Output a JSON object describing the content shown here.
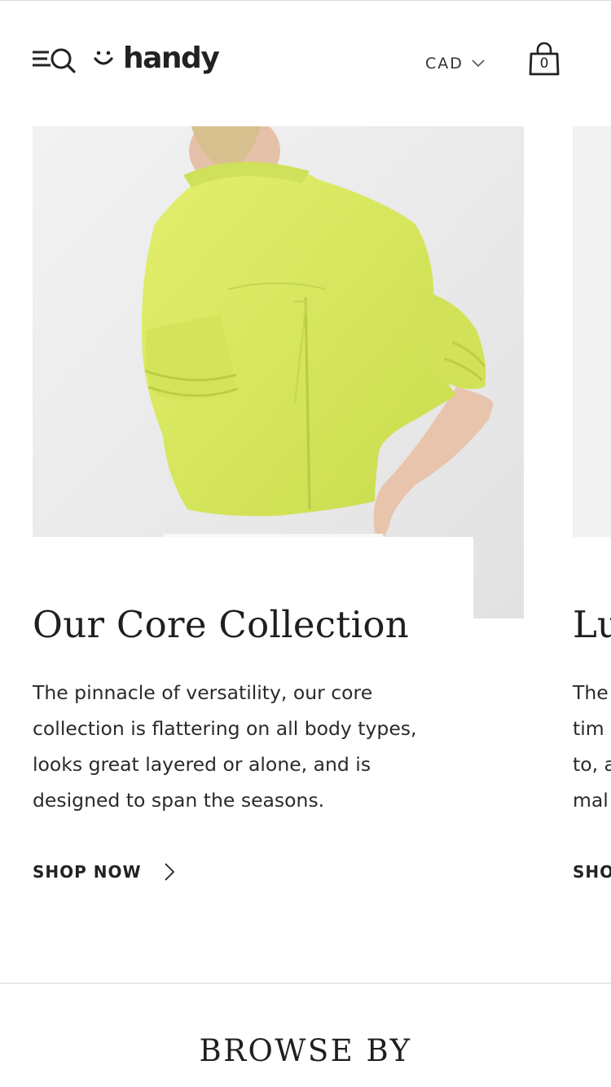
{
  "header": {
    "brand": "handy",
    "currency": "CAD",
    "cart_count": "0"
  },
  "collections": [
    {
      "title": "Our Core Collection",
      "description": "The pinnacle of versatility, our core collection is flattering on all body types, looks great layered or alone, and is designed to span the seasons.",
      "cta": "SHOP NOW"
    },
    {
      "title": "Lu",
      "description_lines": [
        "The",
        "tim",
        "to, a",
        "mal"
      ],
      "cta": "SHO"
    }
  ],
  "browse": {
    "title": "BROWSE BY"
  },
  "colors": {
    "shirt": "#d8ea5c",
    "text": "#222222",
    "divider": "#d6d6d6"
  }
}
